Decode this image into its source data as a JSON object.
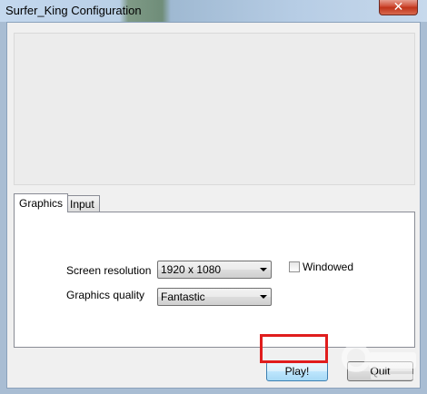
{
  "window": {
    "title": "Surfer_King Configuration",
    "close_glyph": "✕"
  },
  "tabs": [
    {
      "label": "Graphics",
      "active": true
    },
    {
      "label": "Input",
      "active": false
    }
  ],
  "graphics": {
    "resolution_label": "Screen resolution",
    "resolution_value": "1920 x 1080",
    "quality_label": "Graphics quality",
    "quality_value": "Fantastic",
    "windowed_label": "Windowed",
    "windowed_checked": false
  },
  "buttons": {
    "play": "Play!",
    "quit": "Quit"
  },
  "colors": {
    "highlight": "#e01d1d",
    "close_button": "#c0341a"
  },
  "icons": [
    "close-icon",
    "dropdown-arrow-icon"
  ]
}
